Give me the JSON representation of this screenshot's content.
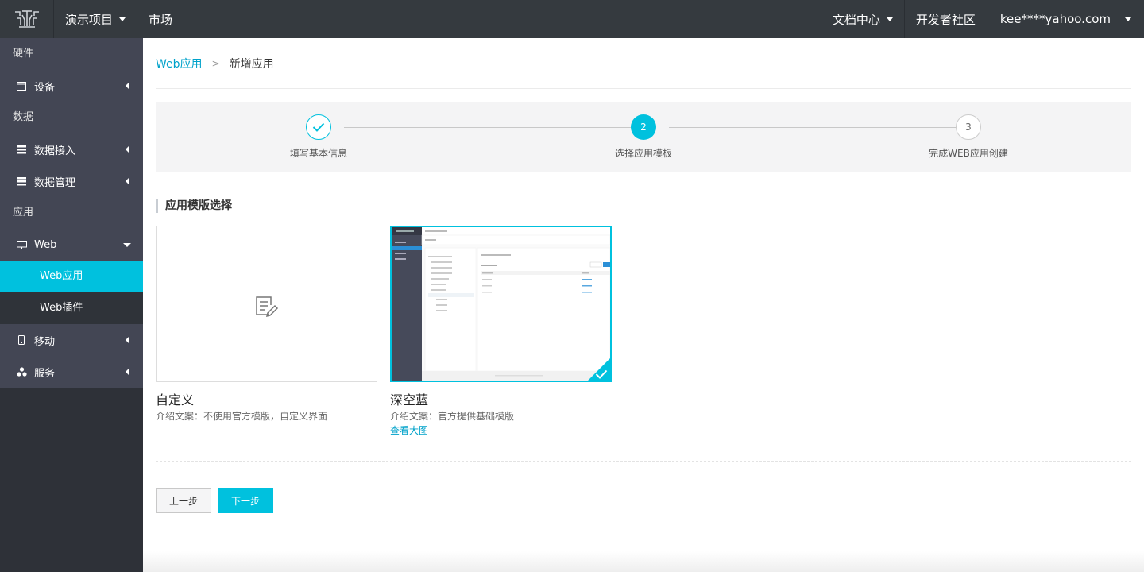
{
  "topbar": {
    "project": "演示项目",
    "market": "市场",
    "docs": "文档中心",
    "community": "开发者社区",
    "user": "kee****yahoo.com"
  },
  "sidebar": {
    "sections": {
      "hardware": "硬件",
      "data": "数据",
      "app": "应用"
    },
    "items": {
      "device": "设备",
      "data_access": "数据接入",
      "data_manage": "数据管理",
      "web": "Web",
      "web_app": "Web应用",
      "web_plugin": "Web插件",
      "mobile": "移动",
      "service": "服务"
    }
  },
  "breadcrumb": {
    "parent": "Web应用",
    "separator": ">",
    "current": "新增应用"
  },
  "steps": [
    {
      "number": "1",
      "label": "填写基本信息",
      "state": "done"
    },
    {
      "number": "2",
      "label": "选择应用模板",
      "state": "active"
    },
    {
      "number": "3",
      "label": "完成WEB应用创建",
      "state": "todo"
    }
  ],
  "section_title": "应用模版选择",
  "templates": [
    {
      "name": "自定义",
      "desc": "介绍文案：不使用官方模版，自定义界面",
      "link": ""
    },
    {
      "name": "深空蓝",
      "desc": "介绍文案：官方提供基础模版",
      "link": "查看大图"
    }
  ],
  "buttons": {
    "prev": "上一步",
    "next": "下一步"
  },
  "colors": {
    "accent": "#00c1de",
    "topbar": "#353a3f",
    "sidebar": "#434654"
  }
}
